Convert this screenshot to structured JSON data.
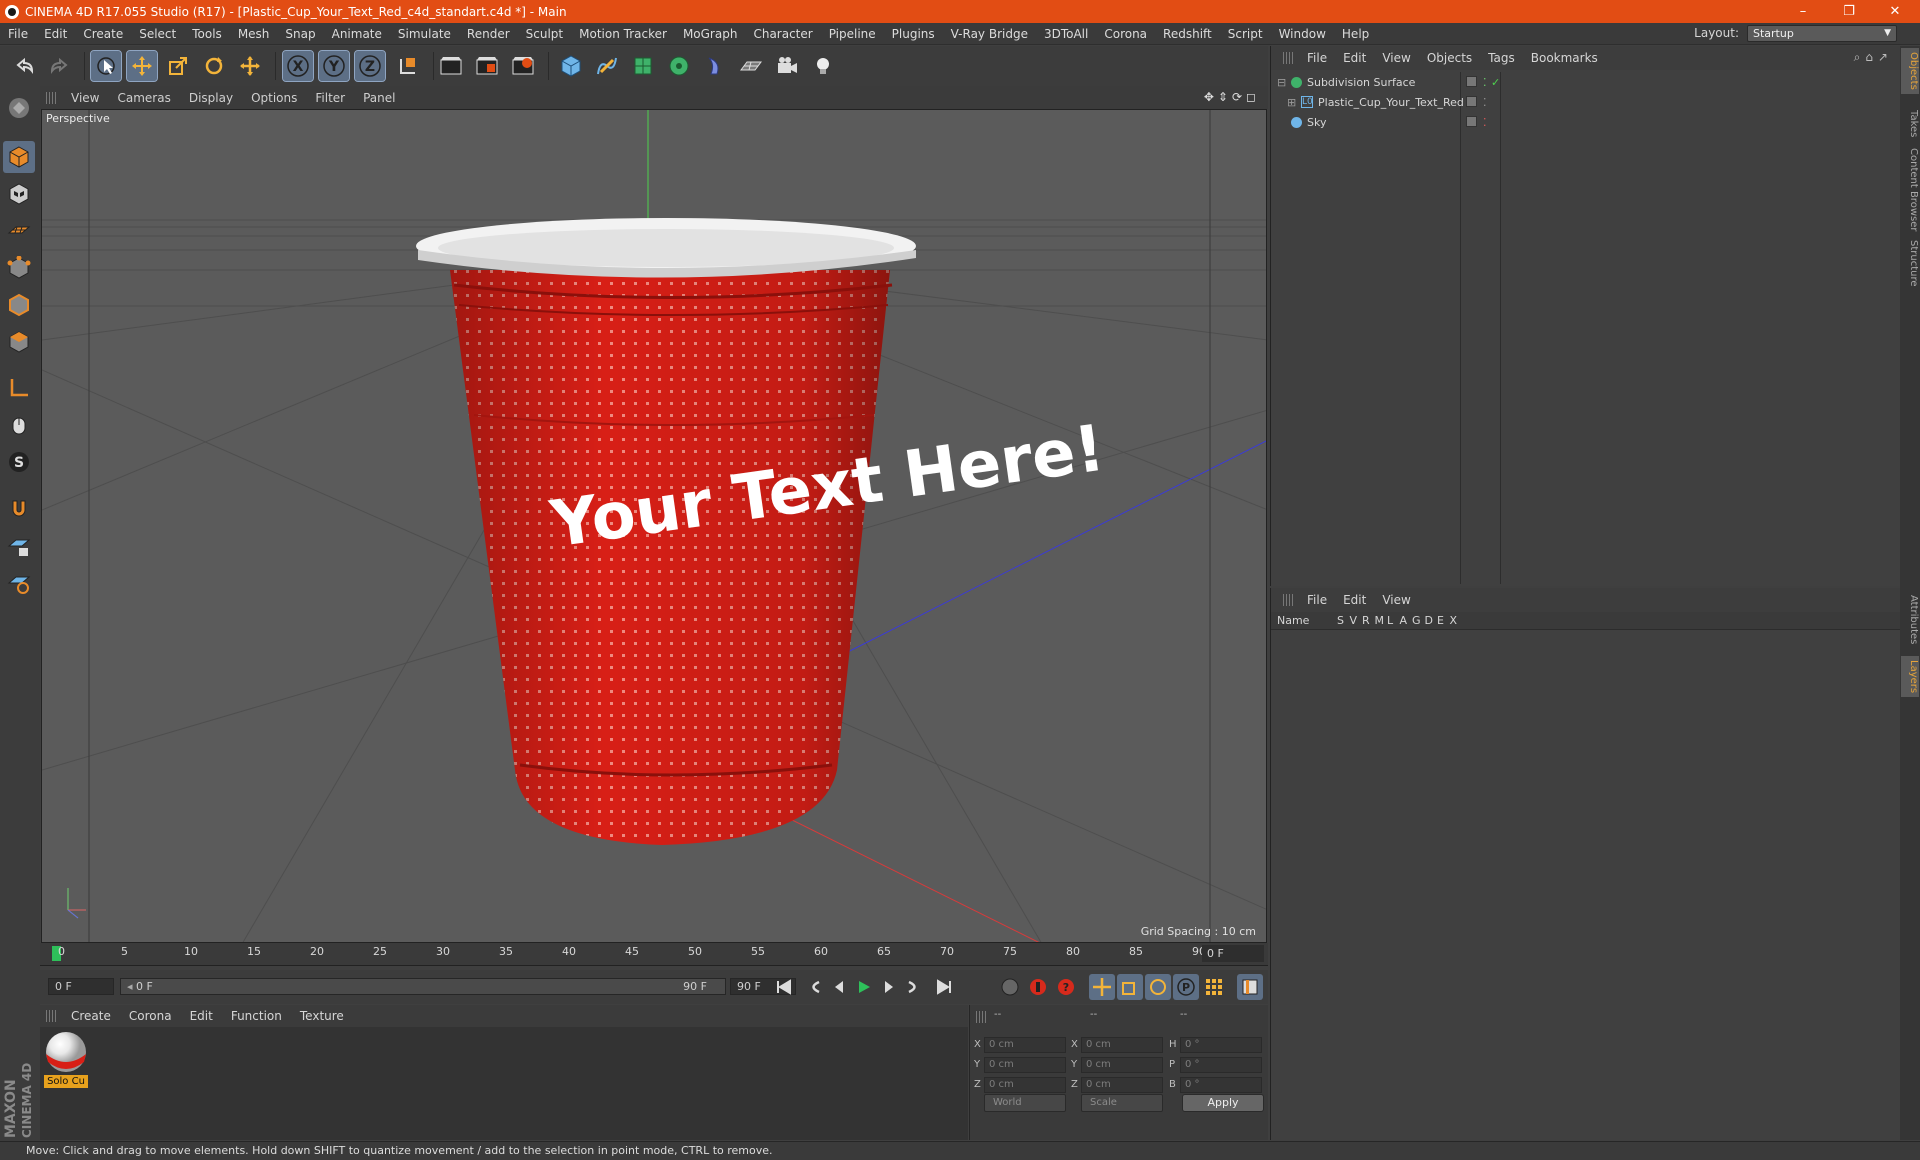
{
  "window": {
    "title": "CINEMA 4D R17.055 Studio (R17) - [Plastic_Cup_Your_Text_Red_c4d_standart.c4d *] - Main",
    "min": "–",
    "max": "❐",
    "close": "✕"
  },
  "menubar": {
    "items": [
      "File",
      "Edit",
      "Create",
      "Select",
      "Tools",
      "Mesh",
      "Snap",
      "Animate",
      "Simulate",
      "Render",
      "Sculpt",
      "Motion Tracker",
      "MoGraph",
      "Character",
      "Pipeline",
      "Plugins",
      "V-Ray Bridge",
      "3DToAll",
      "Corona",
      "Redshift",
      "Script",
      "Window",
      "Help"
    ],
    "layout_label": "Layout:",
    "layout_value": "Startup"
  },
  "viewport": {
    "menu": [
      "View",
      "Cameras",
      "Display",
      "Options",
      "Filter",
      "Panel"
    ],
    "camera": "Perspective",
    "grid_spacing": "Grid Spacing : 10 cm",
    "cup_text": "Your Text Here!"
  },
  "timeline": {
    "ticks": [
      "0",
      "5",
      "10",
      "15",
      "20",
      "25",
      "30",
      "35",
      "40",
      "45",
      "50",
      "55",
      "60",
      "65",
      "70",
      "75",
      "80",
      "85",
      "90"
    ],
    "current": "0 F",
    "start": "0 F",
    "range_start": "0 F",
    "range_end": "90 F",
    "end": "90 F"
  },
  "material": {
    "menu": [
      "Create",
      "Corona",
      "Edit",
      "Function",
      "Texture"
    ],
    "items": [
      {
        "label": "Solo Cu"
      }
    ]
  },
  "coords": {
    "headers": [
      "--",
      "--",
      "--"
    ],
    "rows": [
      {
        "a": "X",
        "av": "0 cm",
        "b": "X",
        "bv": "0 cm",
        "c": "H",
        "cv": "0 °"
      },
      {
        "a": "Y",
        "av": "0 cm",
        "b": "Y",
        "bv": "0 cm",
        "c": "P",
        "cv": "0 °"
      },
      {
        "a": "Z",
        "av": "0 cm",
        "b": "Z",
        "bv": "0 cm",
        "c": "B",
        "cv": "0 °"
      }
    ],
    "world": "World",
    "scale": "Scale",
    "apply": "Apply"
  },
  "objects": {
    "menu": [
      "File",
      "Edit",
      "View",
      "Objects",
      "Tags",
      "Bookmarks"
    ],
    "items": [
      {
        "name": "Subdivision Surface"
      },
      {
        "name": "Plastic_Cup_Your_Text_Red"
      },
      {
        "name": "Sky"
      }
    ]
  },
  "layers": {
    "menu": [
      "File",
      "Edit",
      "View"
    ],
    "header": "Name",
    "columns": [
      "S",
      "V",
      "R",
      "M",
      "L",
      "A",
      "G",
      "D",
      "E",
      "X"
    ]
  },
  "sidetabs": [
    "Objects",
    "Takes",
    "Content Browser",
    "Structure",
    "Attributes",
    "Layers"
  ],
  "status": "Move: Click and drag to move elements. Hold down SHIFT to quantize movement / add to the selection in point mode, CTRL to remove.",
  "maxon": {
    "brand": "MAXON",
    "product": "CINEMA 4D"
  }
}
